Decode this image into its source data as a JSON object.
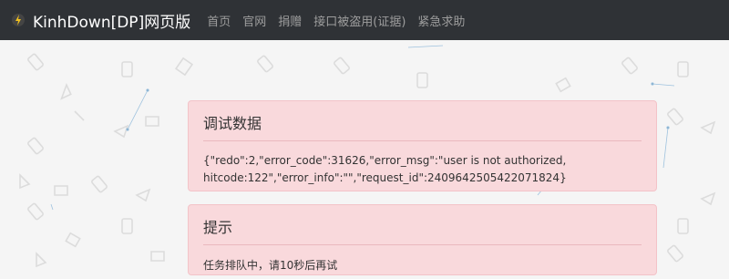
{
  "navbar": {
    "brand": "KinhDown[DP]网页版",
    "links": [
      {
        "label": "首页"
      },
      {
        "label": "官网"
      },
      {
        "label": "捐赠"
      },
      {
        "label": "接口被盗用(证据)"
      },
      {
        "label": "紧急求助"
      }
    ]
  },
  "debug_panel": {
    "title": "调试数据",
    "body": "{\"redo\":2,\"error_code\":31626,\"error_msg\":\"user is not authorized, hitcode:122\",\"error_info\":\"\",\"request_id\":2409642505422071824}"
  },
  "tip_panel": {
    "title": "提示",
    "body": "任务排队中，请10秒后再试"
  },
  "colors": {
    "navbar_bg": "#2f3236",
    "panel_bg": "#f9d9dc",
    "panel_border": "#f3c3c8",
    "page_bg": "#f5f5f5"
  }
}
